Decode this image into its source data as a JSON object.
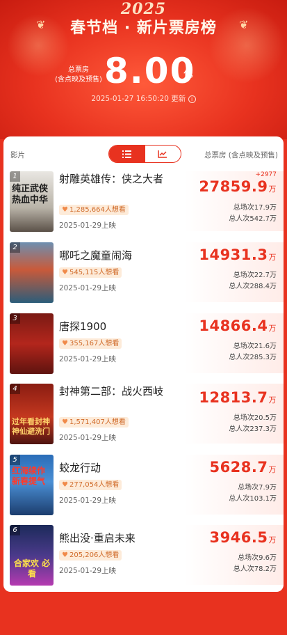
{
  "header": {
    "year": "2025",
    "title": "春节档 · 新片票房榜",
    "total_label_1": "总票房",
    "total_label_2": "(含点映及预售)",
    "total_value": "8.00",
    "total_unit": "亿",
    "update_time": "2025-01-27 16:50:20",
    "update_suffix": "更新",
    "info_icon_glyph": "i"
  },
  "table": {
    "col_film": "影片",
    "col_box": "总票房 (含点映及预售)",
    "toggle_list_icon": "list-icon",
    "toggle_chart_icon": "trend-chart-icon"
  },
  "colors": {
    "accent": "#e8321f",
    "want_bg": "#fdebd9",
    "want_text": "#d06b2a"
  },
  "films": [
    {
      "rank": "1",
      "title": "射雕英雄传：侠之大者",
      "want": "1,285,664人想看",
      "release": "2025-01-29上映",
      "delta": "+2977",
      "box": "27859.9",
      "unit": "万",
      "screenings": "总场次17.9万",
      "audience": "总人次542.7万",
      "poster_text": "纯正武侠 热血中华"
    },
    {
      "rank": "2",
      "title": "哪吒之魔童闹海",
      "want": "545,115人想看",
      "release": "2025-01-29上映",
      "delta": "",
      "box": "14931.3",
      "unit": "万",
      "screenings": "总场次22.7万",
      "audience": "总人次288.4万",
      "poster_text": ""
    },
    {
      "rank": "3",
      "title": "唐探1900",
      "want": "355,167人想看",
      "release": "2025-01-29上映",
      "delta": "",
      "box": "14866.4",
      "unit": "万",
      "screenings": "总场次21.6万",
      "audience": "总人次285.3万",
      "poster_text": ""
    },
    {
      "rank": "4",
      "title": "封神第二部：战火西岐",
      "want": "1,571,407人想看",
      "release": "2025-01-29上映",
      "delta": "",
      "box": "12813.7",
      "unit": "万",
      "screenings": "总场次20.5万",
      "audience": "总人次237.3万",
      "poster_text": "过年看封神 神仙避洗门"
    },
    {
      "rank": "5",
      "title": "蛟龙行动",
      "want": "277,054人想看",
      "release": "2025-01-29上映",
      "delta": "",
      "box": "5628.7",
      "unit": "万",
      "screenings": "总场次7.9万",
      "audience": "总人次103.1万",
      "poster_text": "红海续作 新春提气"
    },
    {
      "rank": "6",
      "title": "熊出没·重启未来",
      "want": "205,206人想看",
      "release": "2025-01-29上映",
      "delta": "",
      "box": "3946.5",
      "unit": "万",
      "screenings": "总场次9.6万",
      "audience": "总人次78.2万",
      "poster_text": "合家欢 必看"
    }
  ]
}
